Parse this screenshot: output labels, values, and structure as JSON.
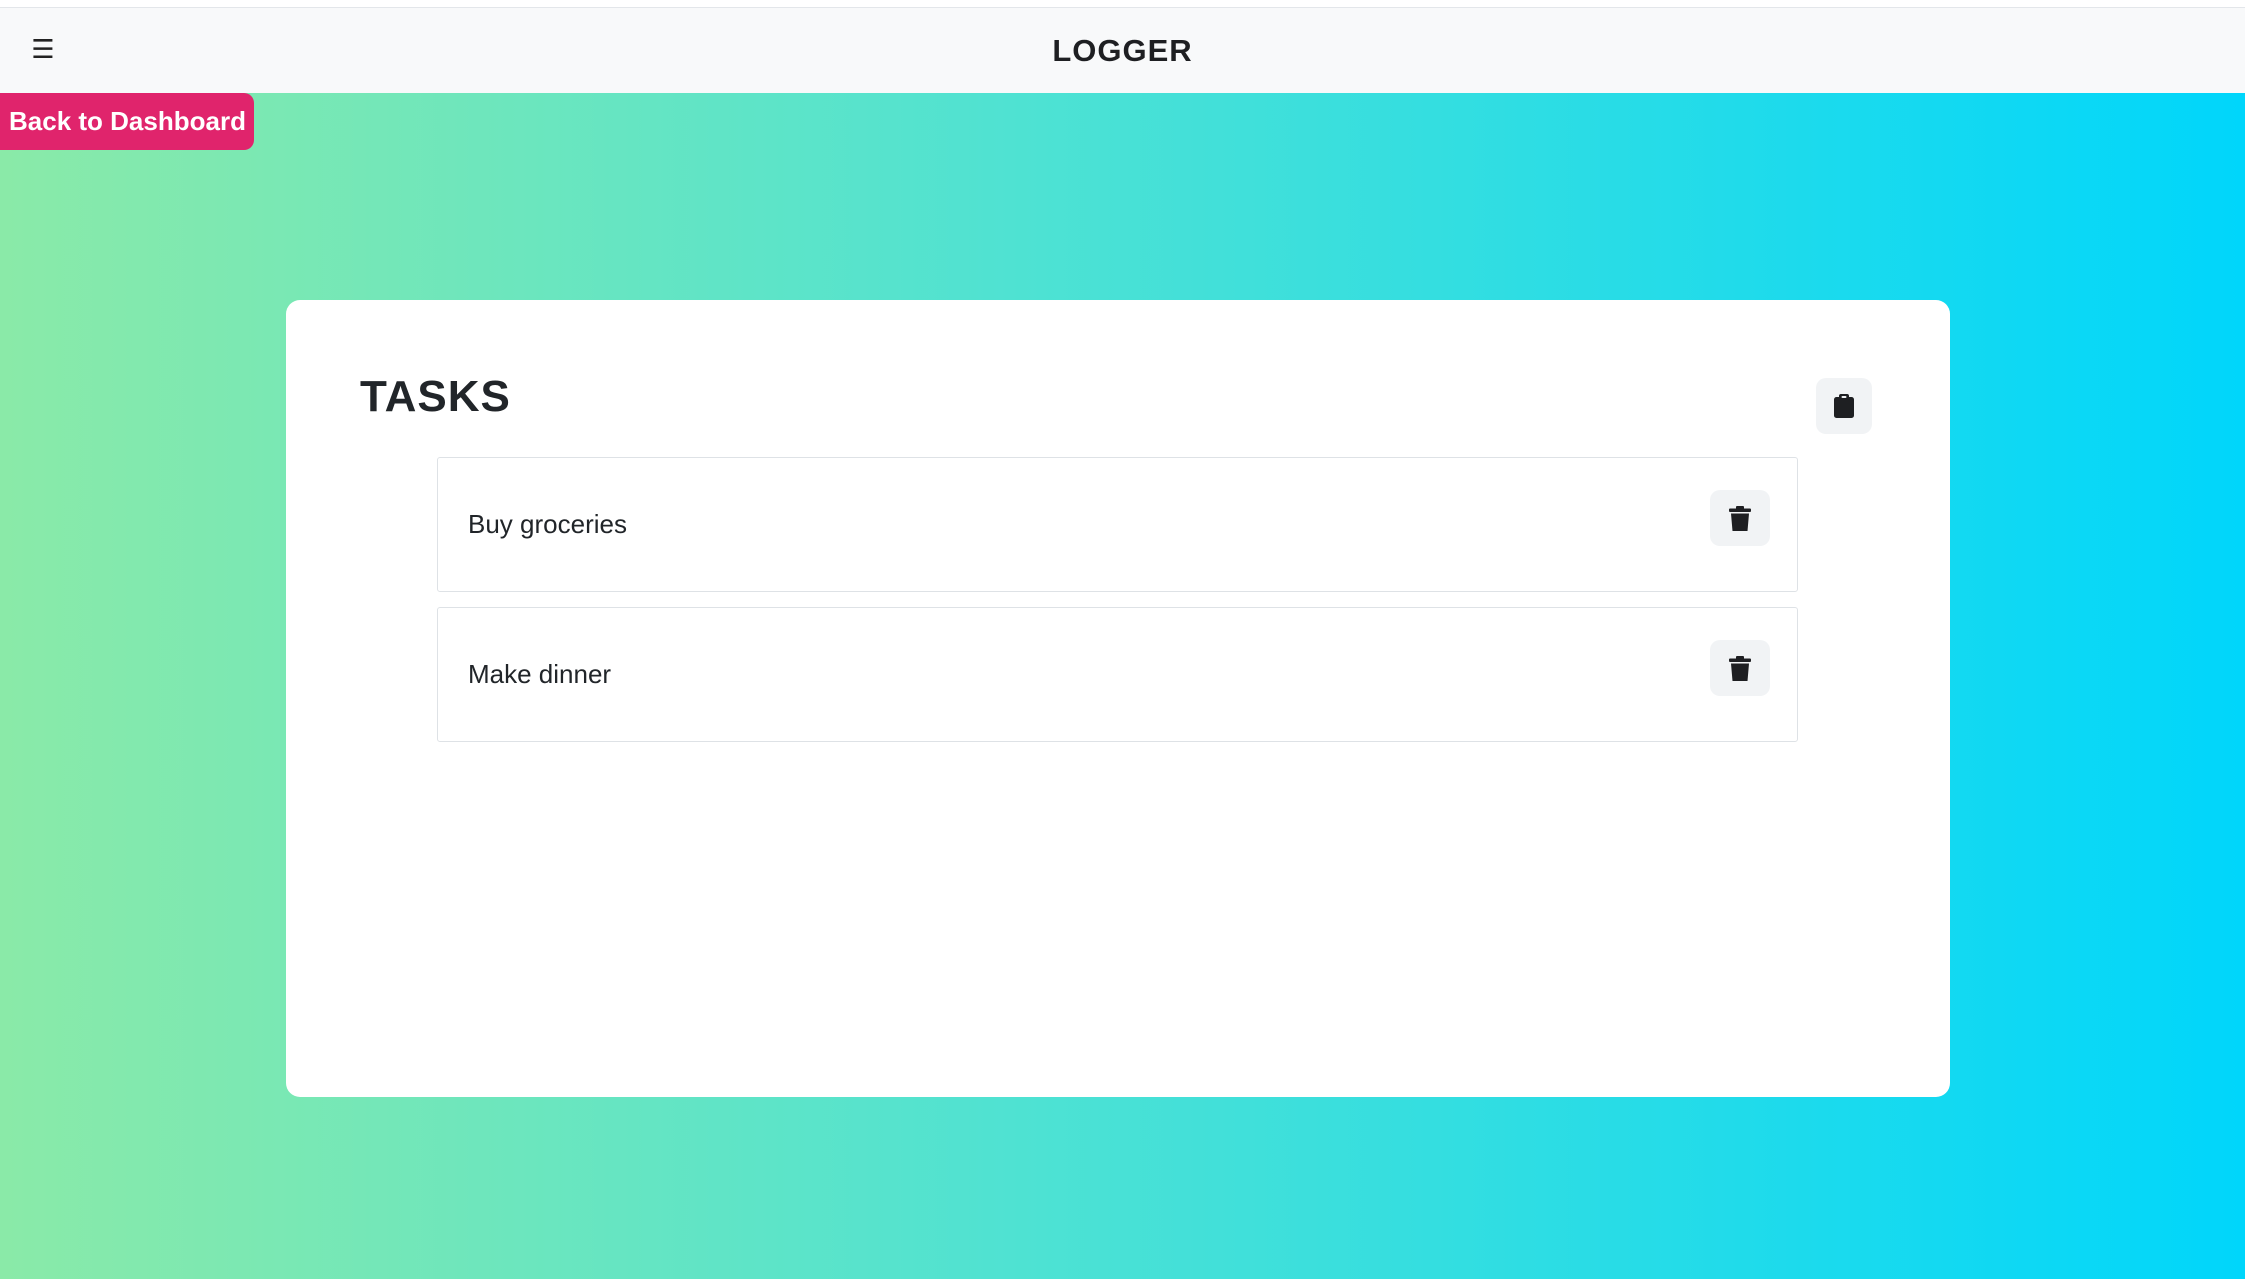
{
  "navbar": {
    "menu_icon": "hamburger-menu-icon",
    "menu_glyph": "☰",
    "brand": "LOGGER"
  },
  "back_button": {
    "label": "Back to Dashboard",
    "color": "#e0246c"
  },
  "tasks_panel": {
    "title": "TASKS",
    "action_icon": "clipboard-icon",
    "items": [
      {
        "label": "Buy groceries",
        "action_icon": "trash-icon"
      },
      {
        "label": "Make dinner",
        "action_icon": "trash-icon"
      }
    ]
  },
  "theme": {
    "background_gradient": [
      "#8aeaa8",
      "#4fe2d2",
      "#00d6fb"
    ],
    "navbar_bg": "#f8f9fa",
    "card_bg": "#ffffff"
  }
}
